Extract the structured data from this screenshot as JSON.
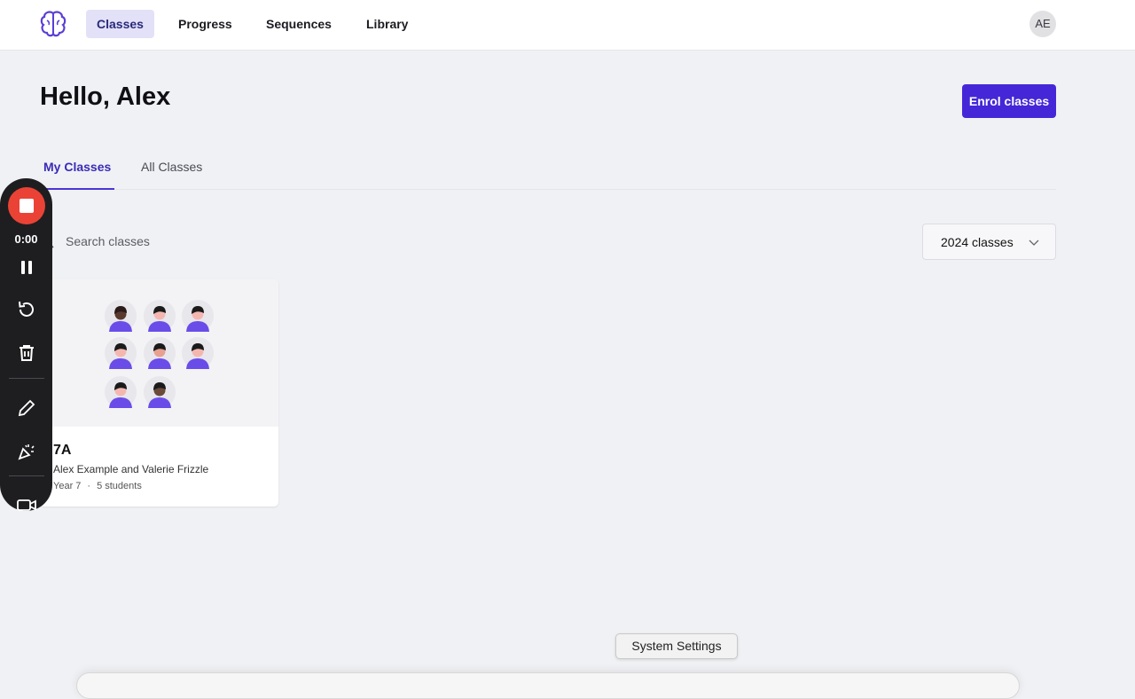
{
  "nav": {
    "items": [
      {
        "label": "Classes",
        "active": true
      },
      {
        "label": "Progress",
        "active": false
      },
      {
        "label": "Sequences",
        "active": false
      },
      {
        "label": "Library",
        "active": false
      }
    ],
    "avatar_initials": "AE"
  },
  "header": {
    "greeting": "Hello, Alex",
    "enrol_label": "Enrol classes"
  },
  "tabs": [
    {
      "label": "My Classes",
      "active": true
    },
    {
      "label": "All Classes",
      "active": false
    }
  ],
  "search": {
    "placeholder": "Search classes"
  },
  "year_filter": {
    "selected": "2024 classes"
  },
  "classes": [
    {
      "name": "7A",
      "teachers": "Alex Example and Valerie Frizzle",
      "year": "Year 7",
      "students": "5 students"
    }
  ],
  "recorder": {
    "time": "0:00"
  },
  "tooltip": "System Settings",
  "colors": {
    "accent": "#4527d8",
    "record": "#ea4335",
    "avatar_purple": "#6a4de8"
  }
}
